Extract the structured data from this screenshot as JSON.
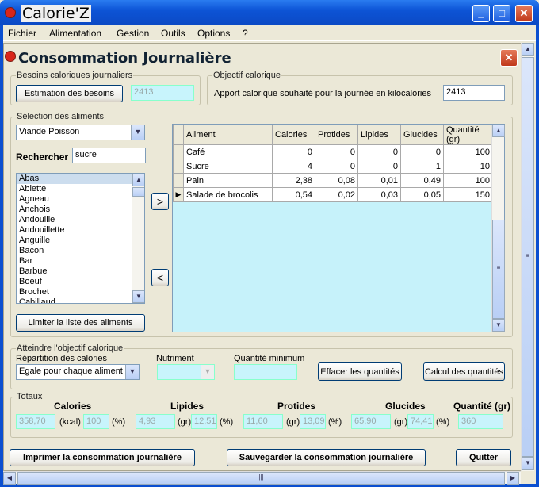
{
  "app": {
    "title": "Calorie'Z"
  },
  "menu": [
    "Fichier",
    "Alimentation",
    "Gestion",
    "Outils",
    "Options",
    "?"
  ],
  "window": {
    "title": "Consommation Journalière"
  },
  "besoins": {
    "group_label": "Besoins caloriques journaliers",
    "button": "Estimation des besoins",
    "value": "2413"
  },
  "objectif": {
    "group_label": "Objectif calorique",
    "label": "Apport calorique souhaité pour la journée en kilocalories",
    "value": "2413"
  },
  "selection": {
    "group_label": "Sélection des aliments",
    "category": "Viande Poisson",
    "search_label": "Rechercher",
    "search_value": "sucre",
    "list": [
      "Abas",
      "Ablette",
      "Agneau",
      "Anchois",
      "Andouille",
      "Andouillette",
      "Anguille",
      "Bacon",
      "Bar",
      "Barbue",
      "Boeuf",
      "Brochet",
      "Cabillaud"
    ],
    "add_label": ">",
    "remove_label": "<",
    "limit_button": "Limiter la liste des aliments"
  },
  "table": {
    "columns": [
      "Aliment",
      "Calories",
      "Protides",
      "Lipides",
      "Glucides",
      "Quantité (gr)"
    ],
    "rows": [
      [
        "Café",
        "0",
        "0",
        "0",
        "0",
        "100"
      ],
      [
        "Sucre",
        "4",
        "0",
        "0",
        "1",
        "10"
      ],
      [
        "Pain",
        "2,38",
        "0,08",
        "0,01",
        "0,49",
        "100"
      ],
      [
        "Salade de brocolis",
        "0,54",
        "0,02",
        "0,03",
        "0,05",
        "150"
      ]
    ]
  },
  "atteindre": {
    "group_label": "Atteindre l'objectif calorique",
    "repartition_label": "Répartition des calories",
    "repartition_value": "Egale pour chaque aliment",
    "nutriment_label": "Nutriment",
    "quantite_label": "Quantité minimum",
    "effacer_button": "Effacer les quantités",
    "calcul_button": "Calcul des quantités"
  },
  "totaux": {
    "group_label": "Totaux",
    "calories": {
      "label": "Calories",
      "value": "358,70",
      "unit": "(kcal)",
      "pct": "100",
      "pct_unit": "(%)"
    },
    "lipides": {
      "label": "Lipides",
      "value": "4,93",
      "unit": "(gr)",
      "pct": "12,51",
      "pct_unit": "(%)"
    },
    "protides": {
      "label": "Protides",
      "value": "11,60",
      "unit": "(gr)",
      "pct": "13,09",
      "pct_unit": "(%)"
    },
    "glucides": {
      "label": "Glucides",
      "value": "65,90",
      "unit": "(gr)",
      "pct": "74,41",
      "pct_unit": "(%)"
    },
    "quantite": {
      "label": "Quantité (gr)",
      "value": "360"
    }
  },
  "footer": {
    "print_button": "Imprimer la consommation journalière",
    "save_button": "Sauvegarder la consommation journalière",
    "quit_button": "Quitter"
  }
}
